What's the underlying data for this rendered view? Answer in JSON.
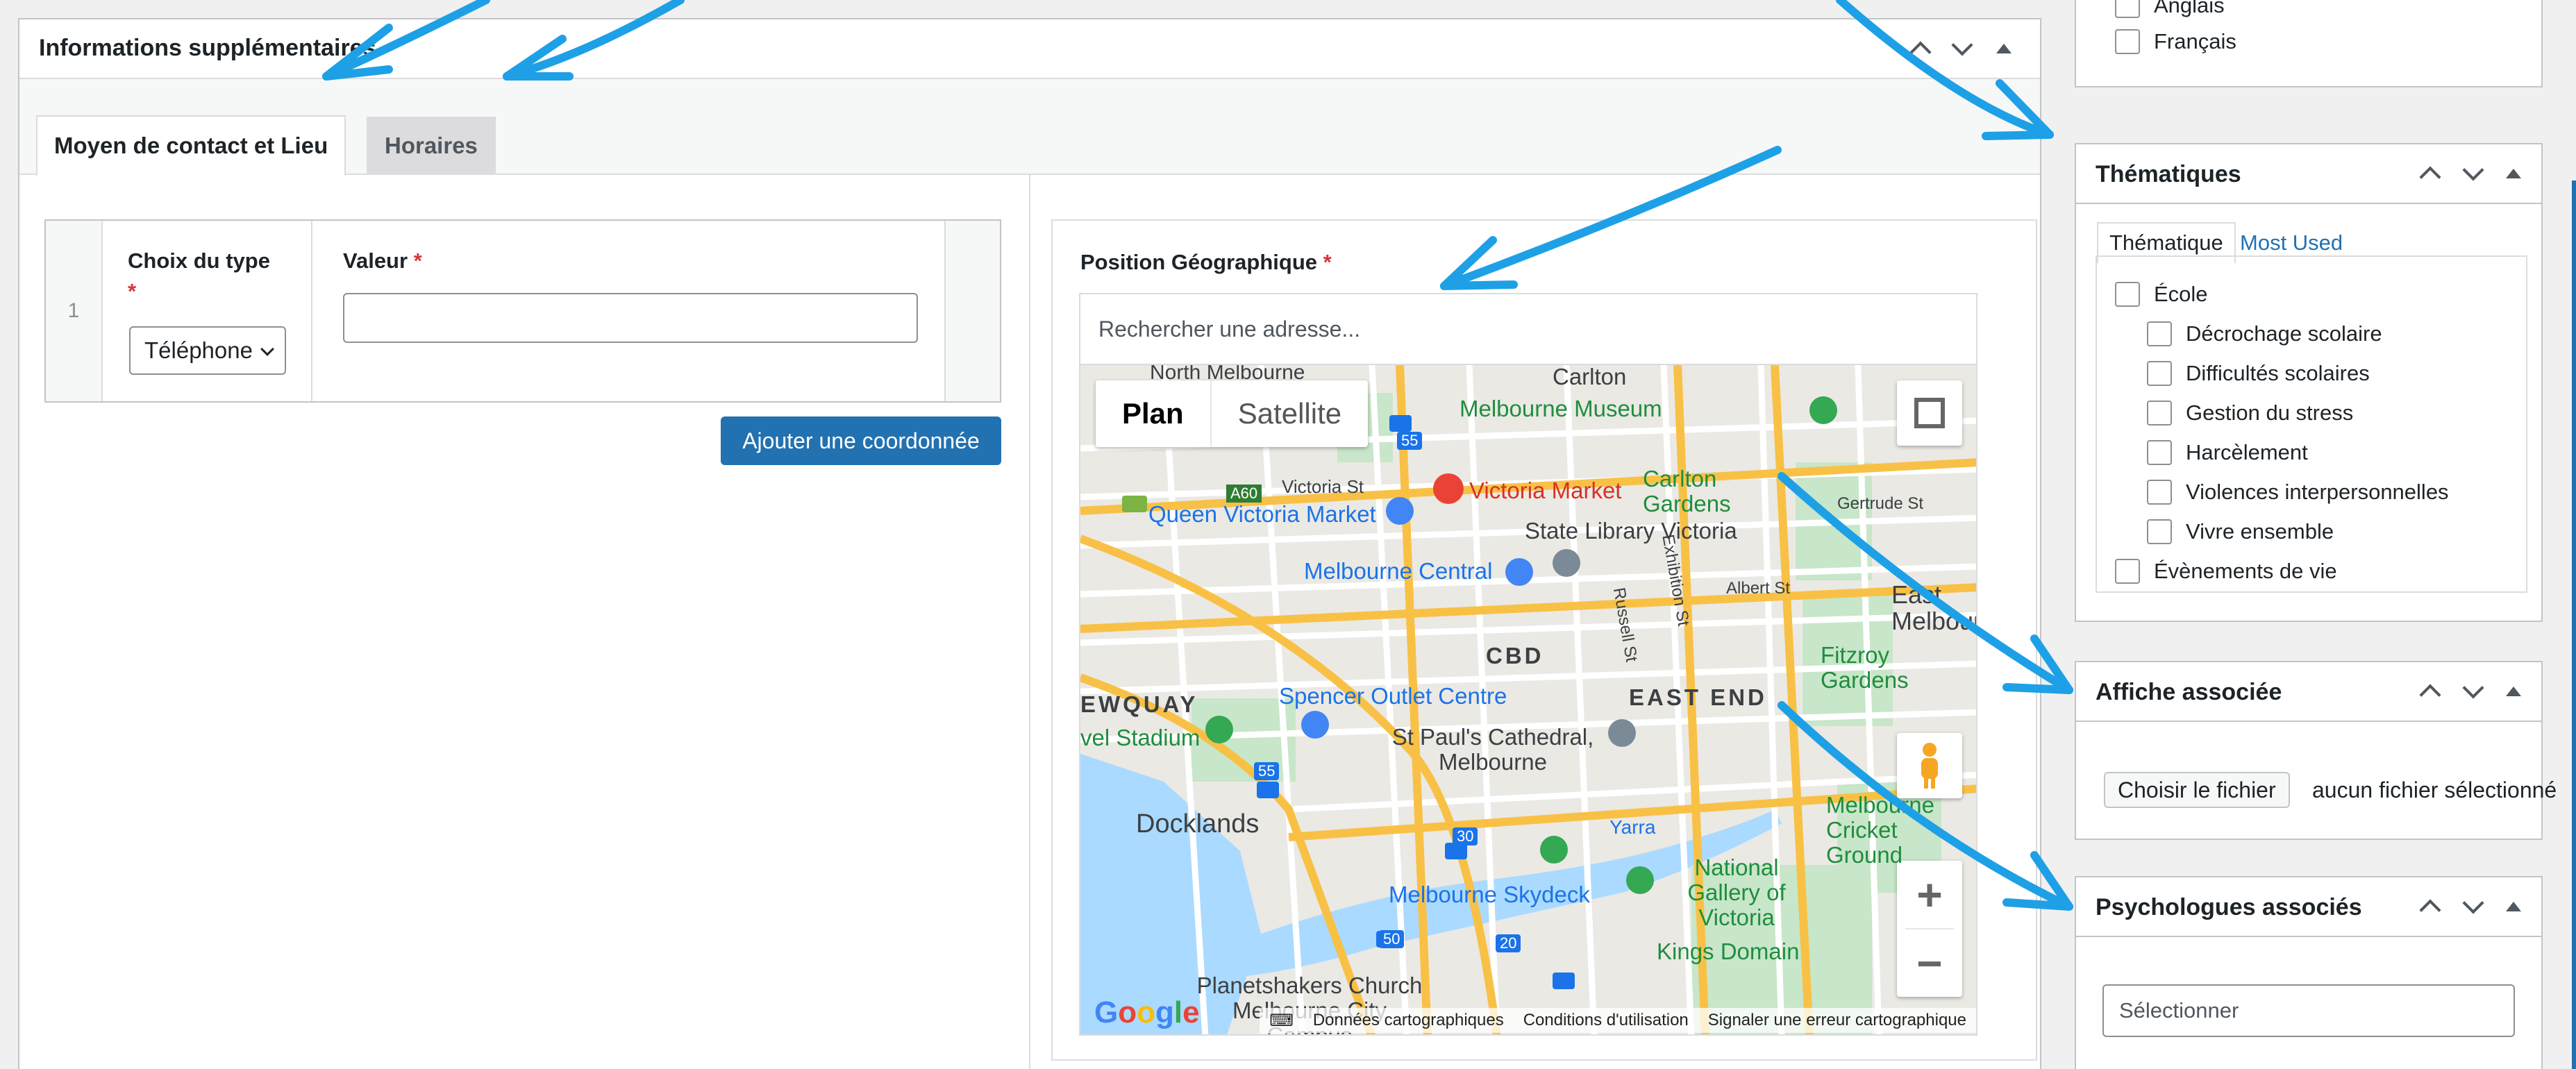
{
  "main_box": {
    "title": "Informations supplémentaires",
    "tabs": [
      "Moyen de contact et Lieu",
      "Horaires"
    ],
    "repeater": {
      "row_number": "1",
      "type_label": "Choix du type",
      "type_required": "*",
      "type_value": "Téléphone",
      "value_label": "Valeur",
      "value_required": "*",
      "value_input": ""
    },
    "add_button": "Ajouter une coordonnée",
    "geo": {
      "label": "Position Géographique",
      "required": "*",
      "search_placeholder": "Rechercher une adresse...",
      "map_type_plan": "Plan",
      "map_type_satellite": "Satellite",
      "map_labels": {
        "carlton": "Carlton",
        "north_melbourne": "North Melbourne",
        "melbourne_museum": "Melbourne Museum",
        "victoria_st": "Victoria St",
        "a60": "A60",
        "r55_top": "55",
        "victoria_market": "Victoria Market",
        "queen_victoria_market": "Queen Victoria Market",
        "carlton_gardens": "Carlton Gardens",
        "gertrude_st": "Gertrude St",
        "state_library": "State Library Victoria",
        "exhibition_st": "Exhibition St",
        "melbourne_central": "Melbourne Central",
        "russell_st": "Russell St",
        "albert_st": "Albert St",
        "east_melbourne": "East Melbourne",
        "cbd": "CBD",
        "fitzroy_gardens": "Fitzroy Gardens",
        "ewquay": "EWQUAY",
        "spencer_outlet": "Spencer Outlet Centre",
        "east_end": "EAST END",
        "stadium": "vel Stadium",
        "st_pauls": "St Paul's Cathedral, Melbourne",
        "r55_mid": "55",
        "docklands": "Docklands",
        "r30": "30",
        "yarra": "Yarra",
        "melbourne_cricket": "Melbourne Cricket Ground",
        "melbourne_skydeck": "Melbourne Skydeck",
        "national_gallery": "National Gallery of Victoria",
        "r50": "50",
        "r20": "20",
        "kings_domain": "Kings Domain",
        "planetshakers": "Planetshakers Church Melbourne City Campus"
      },
      "footer": {
        "keyboard": "⌨",
        "data": "Données cartographiques",
        "terms": "Conditions d'utilisation",
        "report": "Signaler une erreur cartographique"
      },
      "google_logo": "Google"
    }
  },
  "sidebar": {
    "languages": [
      "Anglais",
      "Français"
    ],
    "thematiques": {
      "title": "Thématiques",
      "tab_all": "Thématique",
      "tab_most_used": "Most Used",
      "items": [
        {
          "label": "École",
          "level": 0
        },
        {
          "label": "Décrochage scolaire",
          "level": 1
        },
        {
          "label": "Difficultés scolaires",
          "level": 1
        },
        {
          "label": "Gestion du stress",
          "level": 1
        },
        {
          "label": "Harcèlement",
          "level": 1
        },
        {
          "label": "Violences interpersonnelles",
          "level": 1
        },
        {
          "label": "Vivre ensemble",
          "level": 1
        },
        {
          "label": "Évènements de vie",
          "level": 0
        }
      ]
    },
    "affiche": {
      "title": "Affiche associée",
      "file_button": "Choisir le fichier",
      "file_status": "aucun fichier sélectionné"
    },
    "psychologues": {
      "title": "Psychologues associés",
      "placeholder": "Sélectionner"
    }
  },
  "colors": {
    "accent": "#2271b1",
    "annotation_arrow": "#1ea0e6",
    "required": "#d63638",
    "link": "#2271b1"
  }
}
